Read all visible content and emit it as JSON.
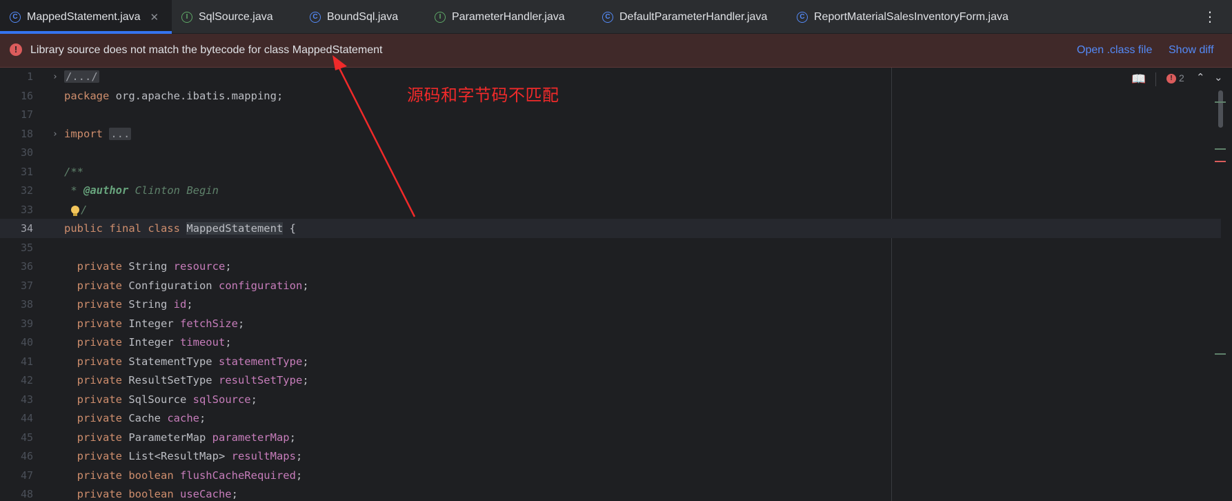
{
  "tabs": [
    {
      "label": "MappedStatement.java",
      "icon": "class-icon",
      "active": true,
      "closable": true
    },
    {
      "label": "SqlSource.java",
      "icon": "interface-icon"
    },
    {
      "label": "BoundSql.java",
      "icon": "class-icon"
    },
    {
      "label": "ParameterHandler.java",
      "icon": "interface-icon"
    },
    {
      "label": "DefaultParameterHandler.java",
      "icon": "class-icon"
    },
    {
      "label": "ReportMaterialSalesInventoryForm.java",
      "icon": "class-icon"
    }
  ],
  "tab_icons": {
    "class": "C",
    "interface": "I",
    "close": "✕",
    "more": "⋮"
  },
  "banner": {
    "message": "Library source does not match the bytecode for class MappedStatement",
    "open_class_label": "Open .class file",
    "show_diff_label": "Show diff",
    "icon": "!"
  },
  "inspection": {
    "error_count": "2",
    "book_icon": "📖",
    "up_icon": "⌃",
    "down_icon": "⌄",
    "error_icon": "!"
  },
  "annotation": {
    "text": "源码和字节码不匹配"
  },
  "fold_glyph": "›",
  "lines": [
    {
      "num": "1",
      "fold": true,
      "parts": [
        {
          "t": "/.../",
          "c": "cmt fold-box"
        }
      ]
    },
    {
      "num": "16",
      "parts": [
        {
          "t": "package ",
          "c": "kw"
        },
        {
          "t": "org.apache.ibatis.mapping;",
          "c": ""
        }
      ]
    },
    {
      "num": "17",
      "parts": []
    },
    {
      "num": "18",
      "fold": true,
      "parts": [
        {
          "t": "import ",
          "c": "kw"
        },
        {
          "t": "...",
          "c": "fold-box"
        }
      ]
    },
    {
      "num": "30",
      "parts": []
    },
    {
      "num": "31",
      "parts": [
        {
          "t": "/**",
          "c": "doc"
        }
      ]
    },
    {
      "num": "32",
      "parts": [
        {
          "t": " * ",
          "c": "doc"
        },
        {
          "t": "@author",
          "c": "doctag"
        },
        {
          "t": " Clinton Begin",
          "c": "doc"
        }
      ]
    },
    {
      "num": "33",
      "bulb": true,
      "parts": [
        {
          "t": "/",
          "c": "doc"
        }
      ]
    },
    {
      "num": "34",
      "current": true,
      "parts": [
        {
          "t": "public final class ",
          "c": "kw"
        },
        {
          "t": "MappedStatement",
          "c": "sel-word"
        },
        {
          "t": " {",
          "c": ""
        }
      ]
    },
    {
      "num": "35",
      "parts": []
    },
    {
      "num": "36",
      "parts": [
        {
          "t": "  private ",
          "c": "kw"
        },
        {
          "t": "String ",
          "c": ""
        },
        {
          "t": "resource",
          "c": "fld"
        },
        {
          "t": ";",
          "c": ""
        }
      ]
    },
    {
      "num": "37",
      "parts": [
        {
          "t": "  private ",
          "c": "kw"
        },
        {
          "t": "Configuration ",
          "c": ""
        },
        {
          "t": "configuration",
          "c": "fld"
        },
        {
          "t": ";",
          "c": ""
        }
      ]
    },
    {
      "num": "38",
      "parts": [
        {
          "t": "  private ",
          "c": "kw"
        },
        {
          "t": "String ",
          "c": ""
        },
        {
          "t": "id",
          "c": "fld"
        },
        {
          "t": ";",
          "c": ""
        }
      ]
    },
    {
      "num": "39",
      "parts": [
        {
          "t": "  private ",
          "c": "kw"
        },
        {
          "t": "Integer ",
          "c": ""
        },
        {
          "t": "fetchSize",
          "c": "fld"
        },
        {
          "t": ";",
          "c": ""
        }
      ]
    },
    {
      "num": "40",
      "parts": [
        {
          "t": "  private ",
          "c": "kw"
        },
        {
          "t": "Integer ",
          "c": ""
        },
        {
          "t": "timeout",
          "c": "fld"
        },
        {
          "t": ";",
          "c": ""
        }
      ]
    },
    {
      "num": "41",
      "parts": [
        {
          "t": "  private ",
          "c": "kw"
        },
        {
          "t": "StatementType ",
          "c": ""
        },
        {
          "t": "statementType",
          "c": "fld"
        },
        {
          "t": ";",
          "c": ""
        }
      ]
    },
    {
      "num": "42",
      "parts": [
        {
          "t": "  private ",
          "c": "kw"
        },
        {
          "t": "ResultSetType ",
          "c": ""
        },
        {
          "t": "resultSetType",
          "c": "fld"
        },
        {
          "t": ";",
          "c": ""
        }
      ]
    },
    {
      "num": "43",
      "parts": [
        {
          "t": "  private ",
          "c": "kw"
        },
        {
          "t": "SqlSource ",
          "c": ""
        },
        {
          "t": "sqlSource",
          "c": "fld"
        },
        {
          "t": ";",
          "c": ""
        }
      ]
    },
    {
      "num": "44",
      "parts": [
        {
          "t": "  private ",
          "c": "kw"
        },
        {
          "t": "Cache ",
          "c": ""
        },
        {
          "t": "cache",
          "c": "fld"
        },
        {
          "t": ";",
          "c": ""
        }
      ]
    },
    {
      "num": "45",
      "parts": [
        {
          "t": "  private ",
          "c": "kw"
        },
        {
          "t": "ParameterMap ",
          "c": ""
        },
        {
          "t": "parameterMap",
          "c": "fld"
        },
        {
          "t": ";",
          "c": ""
        }
      ]
    },
    {
      "num": "46",
      "parts": [
        {
          "t": "  private ",
          "c": "kw"
        },
        {
          "t": "List<ResultMap> ",
          "c": ""
        },
        {
          "t": "resultMaps",
          "c": "fld"
        },
        {
          "t": ";",
          "c": ""
        }
      ]
    },
    {
      "num": "47",
      "parts": [
        {
          "t": "  private ",
          "c": "kw"
        },
        {
          "t": "boolean ",
          "c": "kw"
        },
        {
          "t": "flushCacheRequired",
          "c": "fld"
        },
        {
          "t": ";",
          "c": ""
        }
      ]
    },
    {
      "num": "48",
      "parts": [
        {
          "t": "  private ",
          "c": "kw"
        },
        {
          "t": "boolean ",
          "c": "kw"
        },
        {
          "t": "useCache",
          "c": "fld"
        },
        {
          "t": ";",
          "c": ""
        }
      ]
    }
  ],
  "colors": {
    "accent": "#3574f0",
    "error": "#db5c5c",
    "annotation": "#f02a2a",
    "stripe_green": "#5f826b",
    "stripe_red": "#db5c5c"
  }
}
